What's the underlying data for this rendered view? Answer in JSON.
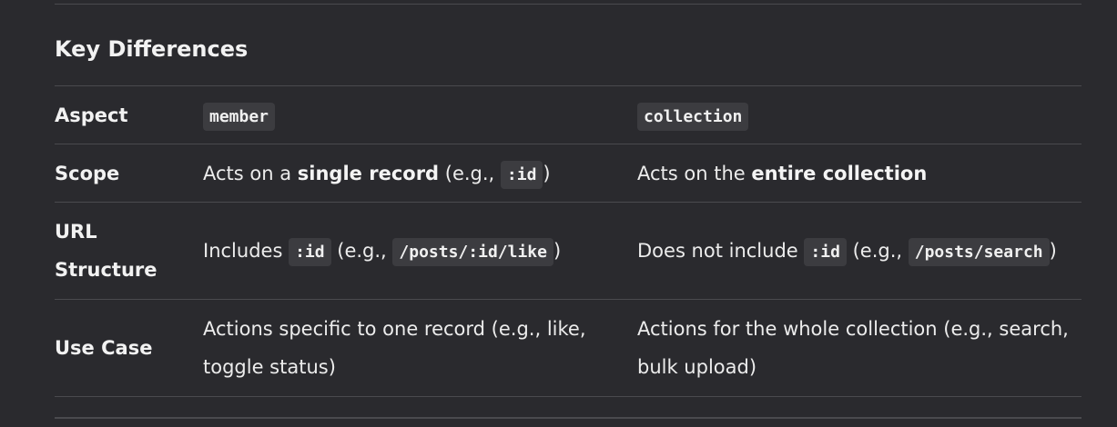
{
  "heading": "Key Differences",
  "table": {
    "header": {
      "aspect": "Aspect",
      "member": "member",
      "collection": "collection"
    },
    "rows": {
      "scope": {
        "label": "Scope",
        "member": {
          "pre": "Acts on a ",
          "bold": "single record",
          "mid": " (e.g., ",
          "code": ":id",
          "post": ")"
        },
        "collection": {
          "pre": "Acts on the ",
          "bold": "entire collection"
        }
      },
      "url": {
        "label": "URL Structure",
        "member": {
          "pre": "Includes ",
          "code1": ":id",
          "mid": " (e.g., ",
          "code2": "/posts/:id/like",
          "post": ")"
        },
        "collection": {
          "pre": "Does not include ",
          "code1": ":id",
          "mid": " (e.g., ",
          "code2": "/posts/search",
          "post": ")"
        }
      },
      "use_case": {
        "label": "Use Case",
        "member": "Actions specific to one record (e.g., like, toggle status)",
        "collection": "Actions for the whole collection (e.g., search, bulk upload)"
      }
    }
  }
}
